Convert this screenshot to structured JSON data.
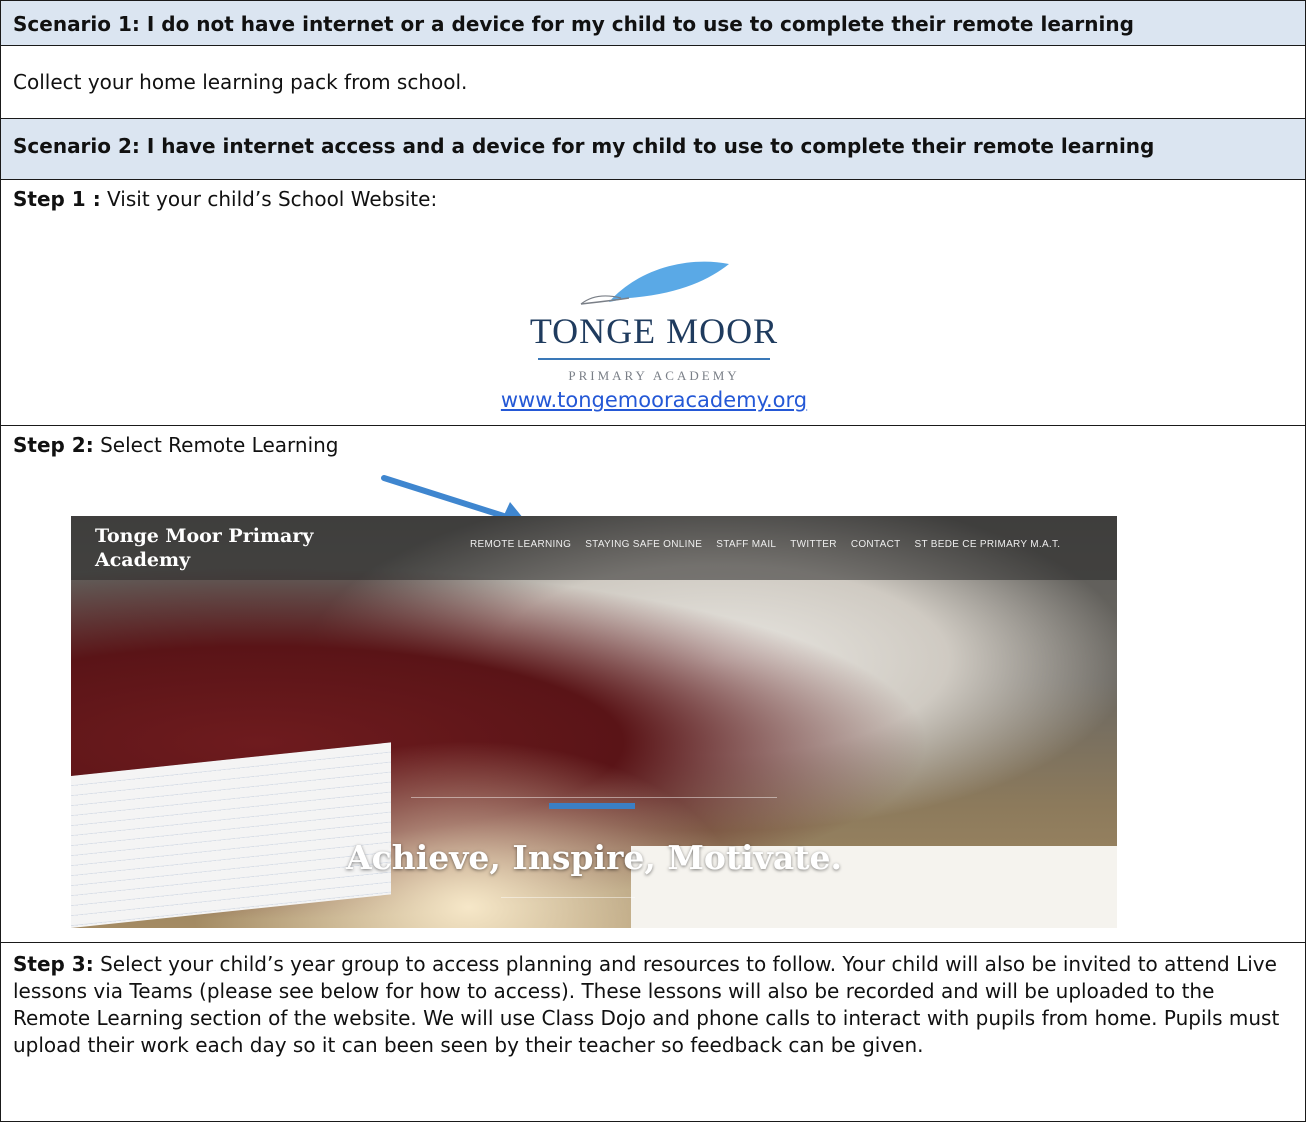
{
  "scenario1": {
    "header": "Scenario 1: I do not have internet or a device for my child to use to complete their remote learning",
    "body": "Collect your home learning pack from school."
  },
  "scenario2": {
    "header": "Scenario 2: I have internet access and a device for my child to use to complete their remote learning"
  },
  "step1": {
    "label": "Step 1 :",
    "text": "Visit your child’s School Website:",
    "logo": {
      "title": "TONGE MOOR",
      "subtitle": "PRIMARY ACADEMY",
      "icon": "feather-quill-icon",
      "color": "#5aa9e6"
    },
    "link": "www.tongemooracademy.org"
  },
  "step2": {
    "label": "Step 2:",
    "text": "Select Remote Learning",
    "arrow_color": "#3f86cf",
    "screenshot": {
      "brand": "Tonge Moor Primary Academy",
      "menu": [
        "REMOTE LEARNING",
        "STAYING SAFE ONLINE",
        "STAFF MAIL",
        "TWITTER",
        "CONTACT",
        "ST BEDE CE PRIMARY M.A.T."
      ],
      "tagline": "Achieve, Inspire, Motivate."
    }
  },
  "step3": {
    "label": "Step 3:",
    "text": "Select your child’s year group to access planning and resources to follow.  Your child will also be invited to attend Live lessons via Teams (please see below for how to access). These lessons will also be recorded and will be uploaded to the Remote Learning section of the website.  We will use Class Dojo and phone calls to interact with pupils from home.  Pupils must upload their work each day so it can been seen by their teacher so feedback can be given."
  }
}
